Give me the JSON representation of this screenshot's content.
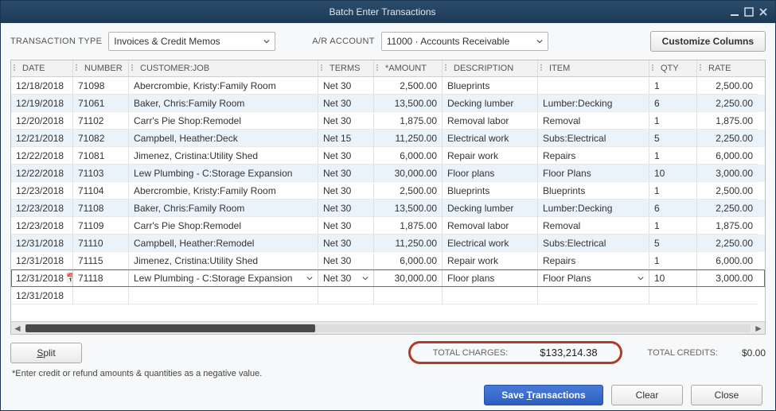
{
  "window": {
    "title": "Batch Enter Transactions"
  },
  "top": {
    "transaction_type_label": "TRANSACTION TYPE",
    "transaction_type_value": "Invoices & Credit Memos",
    "ar_account_label": "A/R ACCOUNT",
    "ar_account_value": "11000 · Accounts Receivable",
    "customize_columns": "Customize Columns"
  },
  "columns": {
    "date": "DATE",
    "number": "NUMBER",
    "customer": "CUSTOMER:JOB",
    "terms": "TERMS",
    "amount": "*AMOUNT",
    "description": "DESCRIPTION",
    "item": "ITEM",
    "qty": "QTY",
    "rate": "RATE"
  },
  "rows": [
    {
      "date": "12/18/2018",
      "number": "71098",
      "customer": "Abercrombie, Kristy:Family Room",
      "terms": "Net 30",
      "amount": "2,500.00",
      "description": "Blueprints",
      "item": "",
      "qty": "1",
      "rate": "2,500.00"
    },
    {
      "date": "12/19/2018",
      "number": "71061",
      "customer": "Baker, Chris:Family Room",
      "terms": "Net 30",
      "amount": "13,500.00",
      "description": "Decking lumber",
      "item": "Lumber:Decking",
      "qty": "6",
      "rate": "2,250.00"
    },
    {
      "date": "12/20/2018",
      "number": "71102",
      "customer": "Carr's Pie Shop:Remodel",
      "terms": "Net 30",
      "amount": "1,875.00",
      "description": "Removal labor",
      "item": "Removal",
      "qty": "1",
      "rate": "1,875.00"
    },
    {
      "date": "12/21/2018",
      "number": "71082",
      "customer": "Campbell, Heather:Deck",
      "terms": "Net 15",
      "amount": "11,250.00",
      "description": "Electrical work",
      "item": "Subs:Electrical",
      "qty": "5",
      "rate": "2,250.00"
    },
    {
      "date": "12/22/2018",
      "number": "71081",
      "customer": "Jimenez, Cristina:Utility Shed",
      "terms": "Net 30",
      "amount": "6,000.00",
      "description": "Repair work",
      "item": "Repairs",
      "qty": "1",
      "rate": "6,000.00"
    },
    {
      "date": "12/22/2018",
      "number": "71103",
      "customer": "Lew Plumbing - C:Storage Expansion",
      "terms": "Net 30",
      "amount": "30,000.00",
      "description": "Floor plans",
      "item": "Floor Plans",
      "qty": "10",
      "rate": "3,000.00"
    },
    {
      "date": "12/23/2018",
      "number": "71104",
      "customer": "Abercrombie, Kristy:Family Room",
      "terms": "Net 30",
      "amount": "2,500.00",
      "description": "Blueprints",
      "item": "Blueprints",
      "qty": "1",
      "rate": "2,500.00"
    },
    {
      "date": "12/23/2018",
      "number": "71108",
      "customer": "Baker, Chris:Family Room",
      "terms": "Net 30",
      "amount": "13,500.00",
      "description": "Decking lumber",
      "item": "Lumber:Decking",
      "qty": "6",
      "rate": "2,250.00"
    },
    {
      "date": "12/23/2018",
      "number": "71109",
      "customer": "Carr's Pie Shop:Remodel",
      "terms": "Net 30",
      "amount": "1,875.00",
      "description": "Removal labor",
      "item": "Removal",
      "qty": "1",
      "rate": "1,875.00"
    },
    {
      "date": "12/31/2018",
      "number": "71110",
      "customer": "Campbell, Heather:Remodel",
      "terms": "Net 30",
      "amount": "11,250.00",
      "description": "Electrical work",
      "item": "Subs:Electrical",
      "qty": "5",
      "rate": "2,250.00"
    },
    {
      "date": "12/31/2018",
      "number": "71115",
      "customer": "Jimenez, Cristina:Utility Shed",
      "terms": "Net 30",
      "amount": "6,000.00",
      "description": "Repair work",
      "item": "Repairs",
      "qty": "1",
      "rate": "6,000.00"
    },
    {
      "date": "12/31/2018",
      "number": "71118",
      "customer": "Lew Plumbing - C:Storage Expansion",
      "terms": "Net 30",
      "amount": "30,000.00",
      "description": "Floor plans",
      "item": "Floor Plans",
      "qty": "10",
      "rate": "3,000.00",
      "active": true
    },
    {
      "date": "12/31/2018",
      "number": "",
      "customer": "",
      "terms": "",
      "amount": "",
      "description": "",
      "item": "",
      "qty": "",
      "rate": ""
    }
  ],
  "totals": {
    "charges_label": "TOTAL CHARGES:",
    "charges_value": "$133,214.38",
    "credits_label": "TOTAL CREDITS:",
    "credits_value": "$0.00"
  },
  "buttons": {
    "split": "Split",
    "save": "Save Transactions",
    "clear": "Clear",
    "close": "Close"
  },
  "hint": "*Enter credit or refund amounts & quantities as a negative value."
}
